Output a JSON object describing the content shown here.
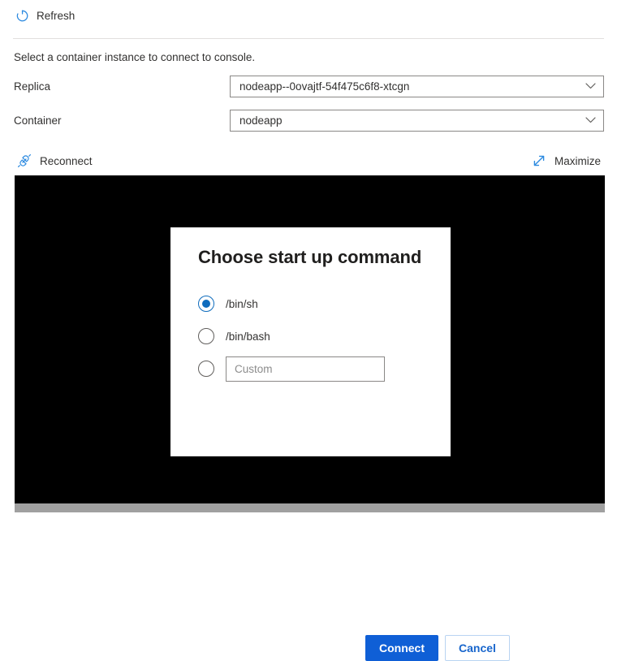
{
  "commandbar": {
    "refresh_label": "Refresh",
    "refresh_icon": "refresh-circular-arrow-icon"
  },
  "instruction": {
    "text": "Select a container instance to connect to console."
  },
  "form": {
    "replica": {
      "label": "Replica",
      "value": "nodeapp--0ovajtf-54f475c6f8-xtcgn",
      "chevron_icon": "chevron-down-icon"
    },
    "container": {
      "label": "Container",
      "value": "nodeapp",
      "chevron_icon": "chevron-down-icon"
    }
  },
  "console_toolbar": {
    "reconnect_label": "Reconnect",
    "reconnect_icon": "plug-connector-icon",
    "maximize_label": "Maximize",
    "maximize_icon": "diagonal-expand-arrows-icon"
  },
  "terminal": {
    "background_color": "#000000",
    "content": ""
  },
  "dialog": {
    "title": "Choose start up command",
    "options": [
      {
        "label": "/bin/sh",
        "selected": true,
        "type": "radio"
      },
      {
        "label": "/bin/bash",
        "selected": false,
        "type": "radio"
      },
      {
        "label": "",
        "selected": false,
        "type": "radio-with-input",
        "input_placeholder": "Custom",
        "input_value": ""
      }
    ],
    "connect_label": "Connect",
    "cancel_label": "Cancel"
  },
  "colors": {
    "accent_blue": "#0f6cbd",
    "primary_button": "#0f5fd6",
    "link_blue": "#1765cc",
    "icon_blue": "#2c8ae0",
    "text": "#323130",
    "border": "#8a8886",
    "divider": "#e1dfdd"
  }
}
